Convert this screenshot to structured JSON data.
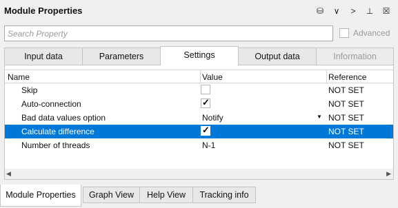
{
  "window": {
    "title": "Module Properties"
  },
  "toolbar": {
    "icons": [
      "database-icon",
      "chevron-down-icon",
      "chevron-right-icon",
      "pin-icon",
      "close-icon"
    ],
    "glyphs": [
      "⛁",
      "∨",
      ">",
      "⊥",
      "☒"
    ]
  },
  "search": {
    "placeholder": "Search Property",
    "value": ""
  },
  "advanced": {
    "label": "Advanced",
    "checked": false
  },
  "tabs": [
    {
      "label": "Input data",
      "active": false,
      "disabled": false
    },
    {
      "label": "Parameters",
      "active": false,
      "disabled": false
    },
    {
      "label": "Settings",
      "active": true,
      "disabled": false
    },
    {
      "label": "Output data",
      "active": false,
      "disabled": false
    },
    {
      "label": "Information",
      "active": false,
      "disabled": true
    }
  ],
  "grid": {
    "headers": {
      "name": "Name",
      "value": "Value",
      "reference": "Reference"
    },
    "rows": [
      {
        "name": "Skip",
        "type": "checkbox",
        "checked": false,
        "value": "",
        "reference": "NOT SET"
      },
      {
        "name": "Auto-connection",
        "type": "checkbox",
        "checked": true,
        "value": "",
        "reference": "NOT SET"
      },
      {
        "name": "Bad data values option",
        "type": "dropdown",
        "value": "Notify",
        "reference": "NOT SET"
      },
      {
        "name": "Calculate difference",
        "type": "checkbox",
        "checked": true,
        "value": "",
        "reference": "NOT SET",
        "selected": true
      },
      {
        "name": "Number of threads",
        "type": "text",
        "value": "N-1",
        "reference": "NOT SET"
      }
    ]
  },
  "check_glyph": "✓",
  "dropdown_glyph": "▼",
  "scroll": {
    "left": "◀",
    "right": "▶"
  },
  "bottom_tabs": [
    {
      "label": "Module Properties",
      "active": true
    },
    {
      "label": "Graph View",
      "active": false
    },
    {
      "label": "Help View",
      "active": false
    },
    {
      "label": "Tracking info",
      "active": false
    }
  ],
  "colors": {
    "selection": "#0078d7"
  }
}
